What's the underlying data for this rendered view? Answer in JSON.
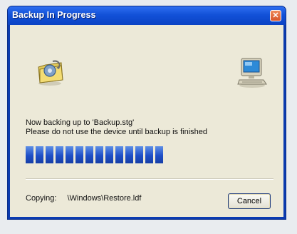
{
  "dialog": {
    "title": "Backup In Progress",
    "status_line1": "Now backing up to 'Backup.stg'",
    "status_line2": "Please do not use the device until backup is finished",
    "progress": 0.58,
    "copying_label": "Copying:",
    "copying_path": "\\Windows\\Restore.ldf",
    "cancel_label": "Cancel",
    "close_glyph": "✕"
  },
  "icons": {
    "source": "folder-gear-icon",
    "destination": "computer-icon",
    "close": "close-icon"
  },
  "colors": {
    "titlebar": "#0b43c4",
    "progress": "#1e4fc7",
    "client_bg": "#ece9d8"
  }
}
